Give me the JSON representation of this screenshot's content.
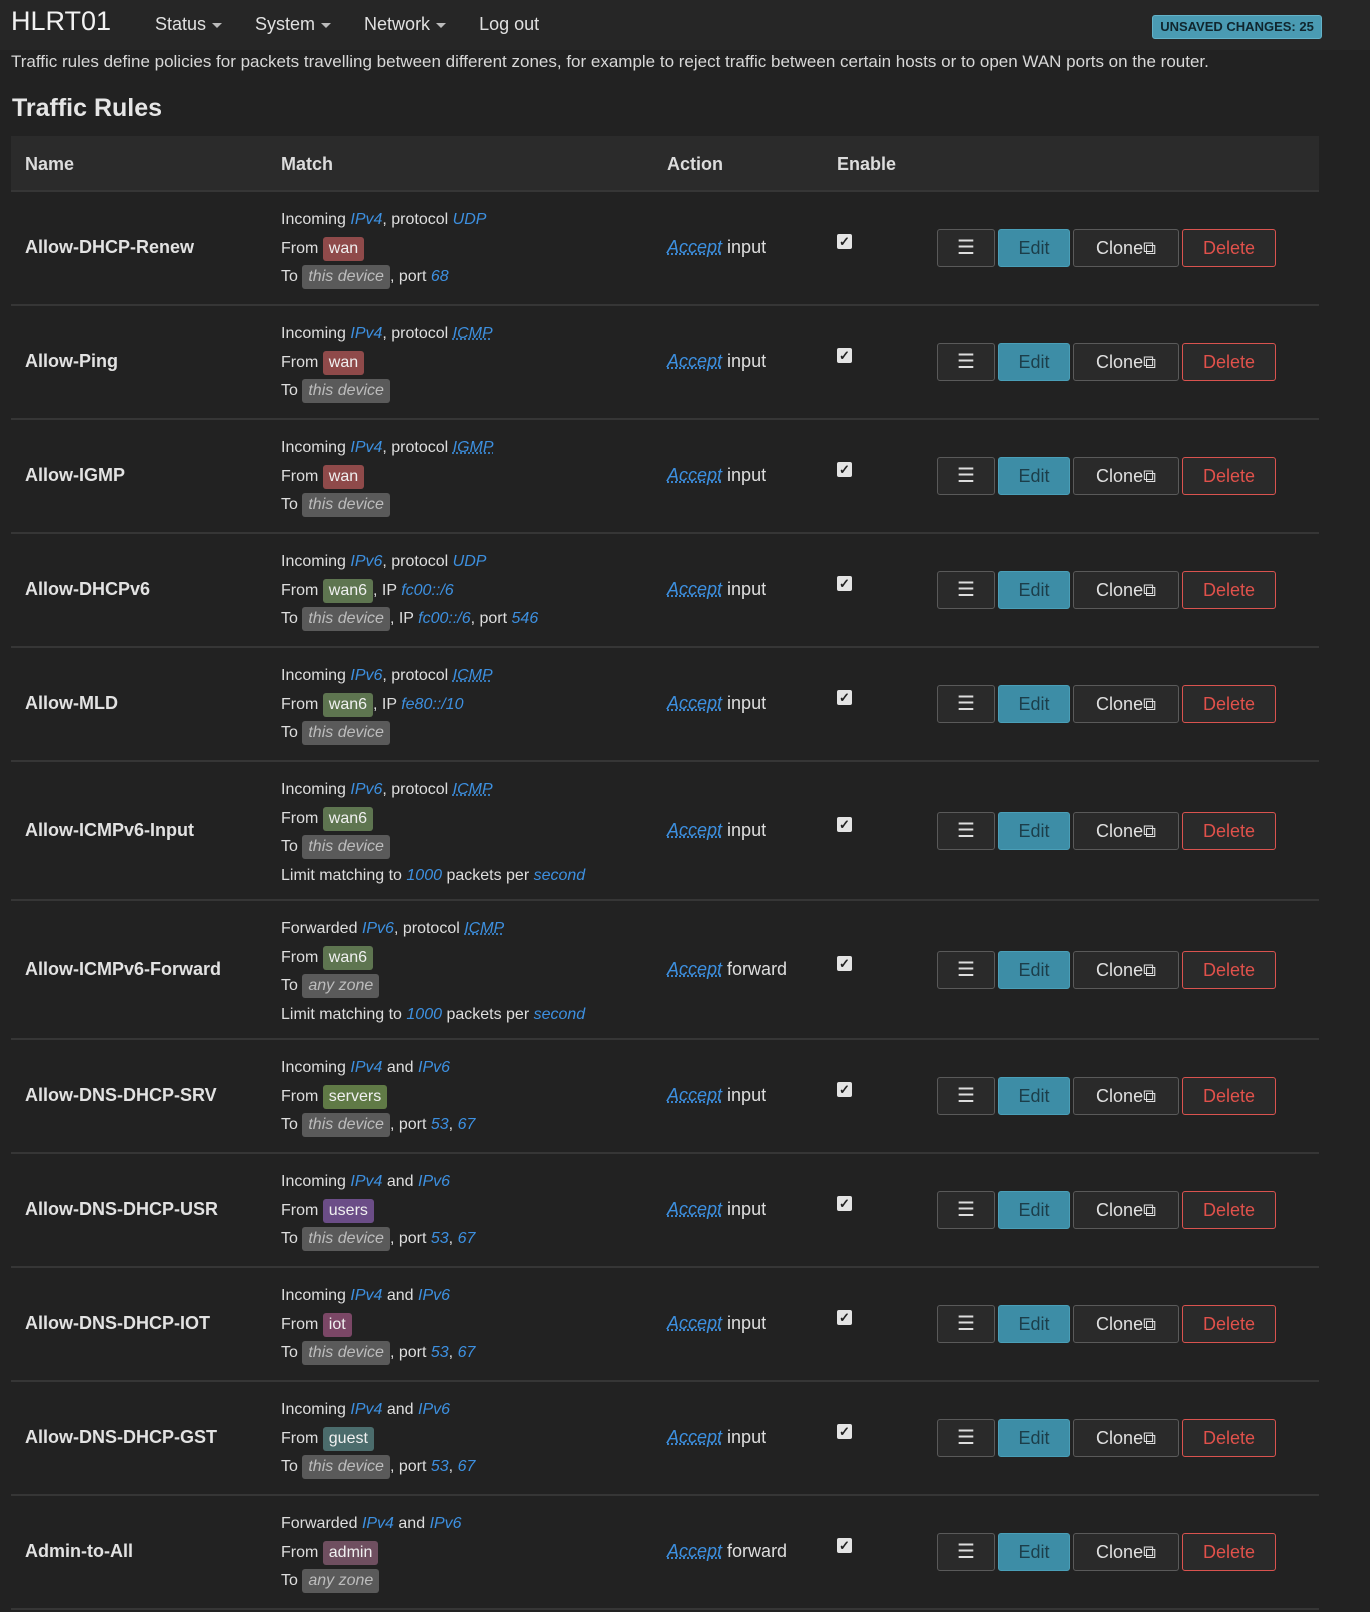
{
  "header": {
    "brand": "HLRT01",
    "menu": [
      {
        "label": "Status",
        "dropdown": true
      },
      {
        "label": "System",
        "dropdown": true
      },
      {
        "label": "Network",
        "dropdown": true
      },
      {
        "label": "Log out",
        "dropdown": false
      }
    ],
    "unsaved_badge": "UNSAVED CHANGES: 25"
  },
  "description": "Traffic rules define policies for packets travelling between different zones, for example to reject traffic between certain hosts or to open WAN ports on the router.",
  "section_title": "Traffic Rules",
  "table": {
    "columns": [
      "Name",
      "Match",
      "Action",
      "Enable"
    ],
    "buttons": {
      "menu": "☰",
      "edit": "Edit",
      "clone": "Clone",
      "delete": "Delete"
    },
    "rows": [
      {
        "name": "Allow-DHCP-Renew",
        "direction": "Incoming",
        "family": [
          "IPv4"
        ],
        "protocol": "UDP",
        "from_zone": "wan",
        "from_ip": "",
        "to_zone": "this device",
        "to_ip": "",
        "ports": [
          "68"
        ],
        "limit": "",
        "action": "Accept",
        "target": "input",
        "enabled": true
      },
      {
        "name": "Allow-Ping",
        "direction": "Incoming",
        "family": [
          "IPv4"
        ],
        "protocol": "ICMP",
        "from_zone": "wan",
        "from_ip": "",
        "to_zone": "this device",
        "to_ip": "",
        "ports": [],
        "limit": "",
        "action": "Accept",
        "target": "input",
        "enabled": true
      },
      {
        "name": "Allow-IGMP",
        "direction": "Incoming",
        "family": [
          "IPv4"
        ],
        "protocol": "IGMP",
        "from_zone": "wan",
        "from_ip": "",
        "to_zone": "this device",
        "to_ip": "",
        "ports": [],
        "limit": "",
        "action": "Accept",
        "target": "input",
        "enabled": true
      },
      {
        "name": "Allow-DHCPv6",
        "direction": "Incoming",
        "family": [
          "IPv6"
        ],
        "protocol": "UDP",
        "from_zone": "wan6",
        "from_ip": "fc00::/6",
        "to_zone": "this device",
        "to_ip": "fc00::/6",
        "ports": [
          "546"
        ],
        "limit": "",
        "action": "Accept",
        "target": "input",
        "enabled": true
      },
      {
        "name": "Allow-MLD",
        "direction": "Incoming",
        "family": [
          "IPv6"
        ],
        "protocol": "ICMP",
        "from_zone": "wan6",
        "from_ip": "fe80::/10",
        "to_zone": "this device",
        "to_ip": "",
        "ports": [],
        "limit": "",
        "action": "Accept",
        "target": "input",
        "enabled": true
      },
      {
        "name": "Allow-ICMPv6-Input",
        "direction": "Incoming",
        "family": [
          "IPv6"
        ],
        "protocol": "ICMP",
        "from_zone": "wan6",
        "from_ip": "",
        "to_zone": "this device",
        "to_ip": "",
        "ports": [],
        "limit": "1000",
        "action": "Accept",
        "target": "input",
        "enabled": true
      },
      {
        "name": "Allow-ICMPv6-Forward",
        "direction": "Forwarded",
        "family": [
          "IPv6"
        ],
        "protocol": "ICMP",
        "from_zone": "wan6",
        "from_ip": "",
        "to_zone": "any zone",
        "to_ip": "",
        "ports": [],
        "limit": "1000",
        "action": "Accept",
        "target": "forward",
        "enabled": true
      },
      {
        "name": "Allow-DNS-DHCP-SRV",
        "direction": "Incoming",
        "family": [
          "IPv4",
          "IPv6"
        ],
        "protocol": "",
        "from_zone": "servers",
        "from_ip": "",
        "to_zone": "this device",
        "to_ip": "",
        "ports": [
          "53",
          "67"
        ],
        "limit": "",
        "action": "Accept",
        "target": "input",
        "enabled": true
      },
      {
        "name": "Allow-DNS-DHCP-USR",
        "direction": "Incoming",
        "family": [
          "IPv4",
          "IPv6"
        ],
        "protocol": "",
        "from_zone": "users",
        "from_ip": "",
        "to_zone": "this device",
        "to_ip": "",
        "ports": [
          "53",
          "67"
        ],
        "limit": "",
        "action": "Accept",
        "target": "input",
        "enabled": true
      },
      {
        "name": "Allow-DNS-DHCP-IOT",
        "direction": "Incoming",
        "family": [
          "IPv4",
          "IPv6"
        ],
        "protocol": "",
        "from_zone": "iot",
        "from_ip": "",
        "to_zone": "this device",
        "to_ip": "",
        "ports": [
          "53",
          "67"
        ],
        "limit": "",
        "action": "Accept",
        "target": "input",
        "enabled": true
      },
      {
        "name": "Allow-DNS-DHCP-GST",
        "direction": "Incoming",
        "family": [
          "IPv4",
          "IPv6"
        ],
        "protocol": "",
        "from_zone": "guest",
        "from_ip": "",
        "to_zone": "this device",
        "to_ip": "",
        "ports": [
          "53",
          "67"
        ],
        "limit": "",
        "action": "Accept",
        "target": "input",
        "enabled": true
      },
      {
        "name": "Admin-to-All",
        "direction": "Forwarded",
        "family": [
          "IPv4",
          "IPv6"
        ],
        "protocol": "",
        "from_zone": "admin",
        "from_ip": "",
        "to_zone": "any zone",
        "to_ip": "",
        "ports": [],
        "limit": "",
        "action": "Accept",
        "target": "forward",
        "enabled": true
      }
    ]
  },
  "phrases": {
    "protocol": "protocol",
    "from": "From",
    "to": "To",
    "ip": "IP",
    "port": "port",
    "and": "and",
    "limit_prefix": "Limit matching to",
    "limit_mid": "packets per",
    "limit_unit": "second"
  }
}
